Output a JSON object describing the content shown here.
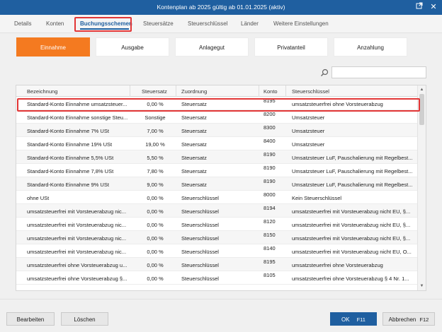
{
  "window": {
    "title": "Kontenplan ab 2025 gültig ab 01.01.2025 (aktiv)"
  },
  "tabs": [
    {
      "label": "Details"
    },
    {
      "label": "Konten"
    },
    {
      "label": "Buchungsschemen"
    },
    {
      "label": "Steuersätze"
    },
    {
      "label": "Steuerschlüssel"
    },
    {
      "label": "Länder"
    },
    {
      "label": "Weitere Einstellungen"
    }
  ],
  "categories": [
    {
      "label": "Einnahme"
    },
    {
      "label": "Ausgabe"
    },
    {
      "label": "Anlagegut"
    },
    {
      "label": "Privatanteil"
    },
    {
      "label": "Anzahlung"
    }
  ],
  "search": {
    "value": "",
    "placeholder": ""
  },
  "grid": {
    "columns": {
      "name": "Bezeichnung",
      "rate": "Steuersatz",
      "zuordnung": "Zuordnung",
      "konto": "Konto",
      "key": "Steuerschlüssel"
    },
    "rows": [
      {
        "name": "Standard-Konto Einnahme umsatzsteuer...",
        "rate": "0,00 %",
        "zuordnung": "Steuersatz",
        "konto": "8195",
        "key": "umsatzsteuerfrei ohne Vorsteuerabzug"
      },
      {
        "name": "Standard-Konto Einnahme sonstige Steu...",
        "rate": "Sonstige",
        "zuordnung": "Steuersatz",
        "konto": "8200",
        "key": "Umsatzsteuer"
      },
      {
        "name": "Standard-Konto Einnahme 7% USt",
        "rate": "7,00 %",
        "zuordnung": "Steuersatz",
        "konto": "8300",
        "key": "Umsatzsteuer"
      },
      {
        "name": "Standard-Konto Einnahme 19% USt",
        "rate": "19,00 %",
        "zuordnung": "Steuersatz",
        "konto": "8400",
        "key": "Umsatzsteuer"
      },
      {
        "name": "Standard-Konto Einnahme 5,5% USt",
        "rate": "5,50 %",
        "zuordnung": "Steuersatz",
        "konto": "8190",
        "key": "Umsatzsteuer LuF, Pauschalierung mit Regelbest..."
      },
      {
        "name": "Standard-Konto Einnahme 7,8% USt",
        "rate": "7,80 %",
        "zuordnung": "Steuersatz",
        "konto": "8190",
        "key": "Umsatzsteuer LuF, Pauschalierung mit Regelbest..."
      },
      {
        "name": "Standard-Konto Einnahme 9% USt",
        "rate": "9,00 %",
        "zuordnung": "Steuersatz",
        "konto": "8190",
        "key": "Umsatzsteuer LuF, Pauschalierung mit Regelbest..."
      },
      {
        "name": "ohne USt",
        "rate": "0,00 %",
        "zuordnung": "Steuerschlüssel",
        "konto": "8000",
        "key": "Kein Steuerschlüssel"
      },
      {
        "name": "umsatzsteuerfrei mit Vorsteuerabzug nic...",
        "rate": "0,00 %",
        "zuordnung": "Steuerschlüssel",
        "konto": "8194",
        "key": "umsatzsteuerfrei mit Vorsteuerabzug nicht EU, §..."
      },
      {
        "name": "umsatzsteuerfrei mit Vorsteuerabzug nic...",
        "rate": "0,00 %",
        "zuordnung": "Steuerschlüssel",
        "konto": "8120",
        "key": "umsatzsteuerfrei mit Vorsteuerabzug nicht EU, §..."
      },
      {
        "name": "umsatzsteuerfrei mit Vorsteuerabzug nic...",
        "rate": "0,00 %",
        "zuordnung": "Steuerschlüssel",
        "konto": "8150",
        "key": "umsatzsteuerfrei mit Vorsteuerabzug nicht EU, §..."
      },
      {
        "name": "umsatzsteuerfrei mit Vorsteuerabzug nic...",
        "rate": "0,00 %",
        "zuordnung": "Steuerschlüssel",
        "konto": "8140",
        "key": "umsatzsteuerfrei mit Vorsteuerabzug nicht EU, O..."
      },
      {
        "name": "umsatzsteuerfrei ohne Vorsteuerabzug u...",
        "rate": "0,00 %",
        "zuordnung": "Steuerschlüssel",
        "konto": "8195",
        "key": "umsatzsteuerfrei ohne Vorsteuerabzug"
      },
      {
        "name": "umsatzsteuerfrei ohne Vorsteuerabzug §...",
        "rate": "0,00 %",
        "zuordnung": "Steuerschlüssel",
        "konto": "8105",
        "key": "umsatzsteuerfrei ohne Vorsteuerabzug § 4 Nr. 1..."
      }
    ]
  },
  "footer": {
    "edit_label": "Bearbeiten",
    "delete_label": "Löschen",
    "ok_label": "OK",
    "ok_key": "F11",
    "cancel_label": "Abbrechen",
    "cancel_key": "F12"
  },
  "colors": {
    "accent": "#1f5fa0",
    "orange": "#f47a20",
    "highlight": "#e23636"
  }
}
